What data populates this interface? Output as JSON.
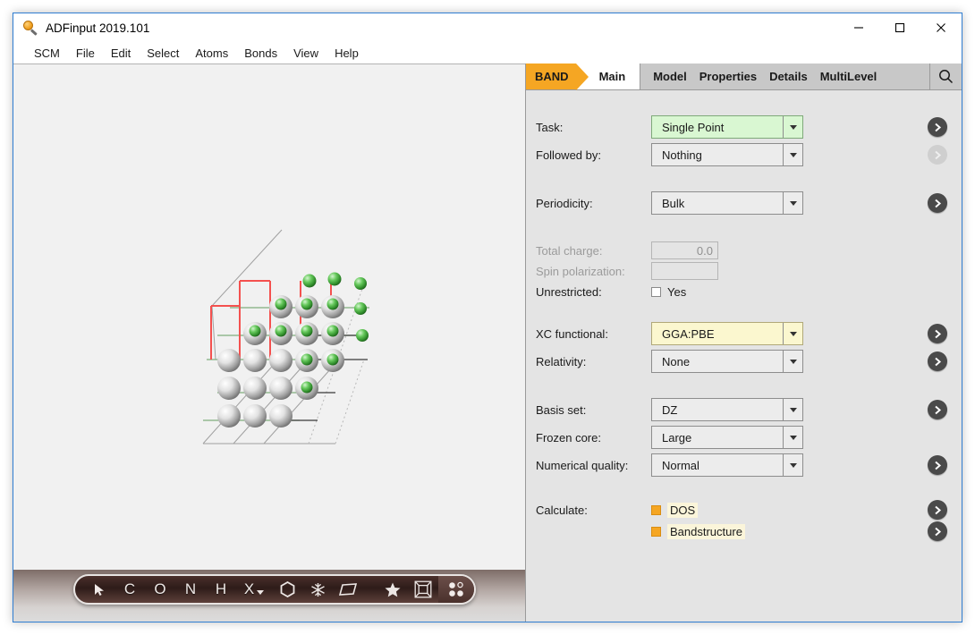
{
  "window": {
    "title": "ADFinput 2019.101",
    "icon": "magnifier-icon",
    "minimize_label": "−",
    "maximize_label": "□",
    "close_label": "✕"
  },
  "menubar": {
    "items": [
      "SCM",
      "File",
      "Edit",
      "Select",
      "Atoms",
      "Bonds",
      "View",
      "Help"
    ]
  },
  "tabbar": {
    "program": "BAND",
    "active_tab": "Main",
    "tabs": [
      "Model",
      "Properties",
      "Details",
      "MultiLevel"
    ],
    "search_icon": "search-icon",
    "accent_color": "#f5a623"
  },
  "form": {
    "task": {
      "label": "Task:",
      "value": "Single Point",
      "highlight": "#d9f7d2",
      "has_go": true,
      "go_enabled": true
    },
    "followed_by": {
      "label": "Followed by:",
      "value": "Nothing",
      "has_go": true,
      "go_enabled": false
    },
    "periodicity": {
      "label": "Periodicity:",
      "value": "Bulk",
      "has_go": true,
      "go_enabled": true
    },
    "total_charge": {
      "label": "Total charge:",
      "value": "0.0",
      "disabled": true
    },
    "spin_polarization": {
      "label": "Spin polarization:",
      "value": "",
      "disabled": true
    },
    "unrestricted": {
      "label": "Unrestricted:",
      "checkbox_label": "Yes",
      "checked": false
    },
    "xc_functional": {
      "label": "XC functional:",
      "value": "GGA:PBE",
      "highlight": "#fbf7cf",
      "has_go": true,
      "go_enabled": true
    },
    "relativity": {
      "label": "Relativity:",
      "value": "None",
      "has_go": true,
      "go_enabled": true
    },
    "basis_set": {
      "label": "Basis set:",
      "value": "DZ",
      "has_go": true,
      "go_enabled": true
    },
    "frozen_core": {
      "label": "Frozen core:",
      "value": "Large",
      "has_go": false
    },
    "numerical_quality": {
      "label": "Numerical quality:",
      "value": "Normal",
      "has_go": true,
      "go_enabled": true
    },
    "calculate": {
      "label": "Calculate:",
      "options": [
        {
          "label": "DOS",
          "checked": true
        },
        {
          "label": "Bandstructure",
          "checked": true
        }
      ]
    }
  },
  "viewer": {
    "toolbar": [
      {
        "name": "select-cursor-icon",
        "glyph": "➤"
      },
      {
        "name": "carbon-atom-icon",
        "glyph": "C"
      },
      {
        "name": "oxygen-atom-icon",
        "glyph": "O"
      },
      {
        "name": "nitrogen-atom-icon",
        "glyph": "N"
      },
      {
        "name": "hydrogen-atom-icon",
        "glyph": "H"
      },
      {
        "name": "element-picker-icon",
        "glyph": "X"
      },
      {
        "name": "ring-icon",
        "glyph": "⬡"
      },
      {
        "name": "snowflake-icon",
        "glyph": "❄"
      },
      {
        "name": "plane-icon",
        "glyph": "▱"
      },
      {
        "name": "favorites-star-icon",
        "glyph": "★"
      },
      {
        "name": "unit-cell-icon",
        "glyph": "⧉"
      },
      {
        "name": "lattice-grid-icon",
        "glyph": "∷"
      }
    ],
    "structure": {
      "description": "Periodic bulk crystal lattice",
      "atom_colors": {
        "metal": "#d8d8d8",
        "adsorbate": "#58c050"
      }
    }
  }
}
